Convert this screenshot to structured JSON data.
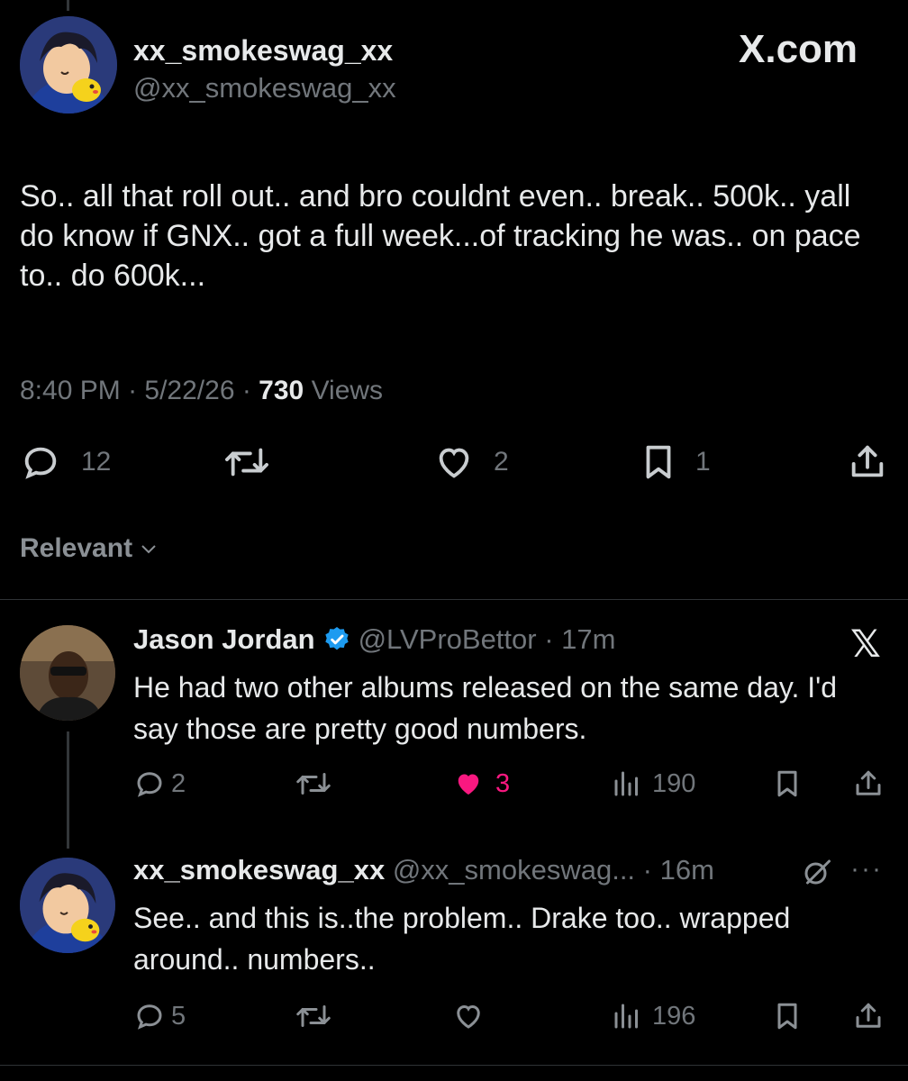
{
  "main_tweet": {
    "display_name": "xx_smokeswag_xx",
    "handle": "@xx_smokeswag_xx",
    "watermark": "X.com",
    "text": "So.. all that roll out.. and bro couldnt even.. break.. 500k.. yall do know if GNX.. got a full week...of tracking he was.. on pace to.. do 600k...",
    "time": "8:40 PM",
    "date": "5/22/26",
    "views_count": "730",
    "views_label": "Views",
    "replies": "12",
    "likes": "2",
    "bookmarks": "1"
  },
  "sort": {
    "label": "Relevant"
  },
  "replies": [
    {
      "display_name": "Jason Jordan",
      "handle": "@LVProBettor",
      "time": "17m",
      "text": "He had two other albums released on the same day. I'd say those are pretty good numbers.",
      "replies": "2",
      "likes": "3",
      "liked": true,
      "views": "190"
    },
    {
      "display_name": "xx_smokeswag_xx",
      "handle": "@xx_smokeswag...",
      "time": "16m",
      "text": "See.. and this is..the problem.. Drake too.. wrapped around.. numbers..",
      "replies": "5",
      "likes": "",
      "liked": false,
      "views": "196"
    }
  ],
  "colors": {
    "background": "#000000",
    "text": "#e7e9ea",
    "muted": "#71767b",
    "like_active": "#f91880",
    "verified": "#1d9bf0"
  }
}
